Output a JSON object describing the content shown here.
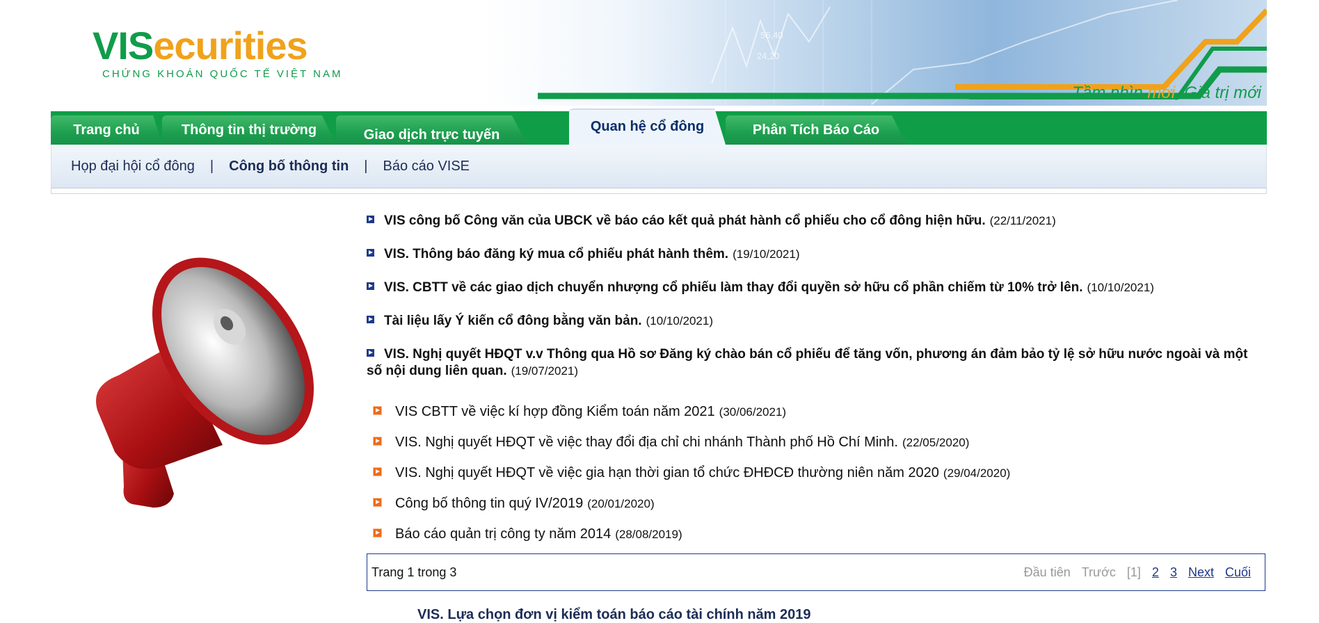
{
  "logo": {
    "vis": "VIS",
    "securities": "ecurities",
    "subtitle": "CHỨNG KHOÁN QUỐC TẾ VIỆT NAM"
  },
  "banner": {
    "slogan_a": "Tầm nhìn ",
    "slogan_b": "mới",
    "slogan_c": ", Giá trị mới",
    "chart_numbers": [
      "56,40",
      "24,20"
    ]
  },
  "nav": {
    "tabs": [
      {
        "label": "Trang chủ"
      },
      {
        "label": "Thông tin thị trường"
      },
      {
        "label": "Giao dịch trực tuyến"
      },
      {
        "label": "Quan hệ cổ đông"
      },
      {
        "label": "Phân Tích Báo Cáo"
      }
    ],
    "active_tab": "Quan hệ cổ đông"
  },
  "subnav": {
    "items": [
      {
        "label": "Họp đại hội cổ đông"
      },
      {
        "label": "Công bố thông tin"
      },
      {
        "label": "Báo cáo VISE"
      }
    ],
    "separator": "|"
  },
  "news": [
    {
      "title": "VIS công bố Công văn của UBCK về báo cáo kết quả phát hành cổ phiếu cho cổ đông hiện hữu.",
      "date": "(22/11/2021)"
    },
    {
      "title": "VIS. Thông báo đăng ký mua cổ phiếu phát hành thêm.",
      "date": "(19/10/2021)"
    },
    {
      "title": "VIS. CBTT về các giao dịch chuyển nhượng cổ phiếu làm thay đổi quyền sở hữu cổ phần chiếm từ 10% trở lên.",
      "date": "(10/10/2021)"
    },
    {
      "title": "Tài liệu lấy Ý kiến cổ đông bằng văn bản.",
      "date": "(10/10/2021)"
    },
    {
      "title": "VIS. Nghị quyết HĐQT v.v Thông qua Hồ sơ Đăng ký chào bán cổ phiếu để tăng vốn, phương án đảm bảo tỷ lệ sở hữu nước ngoài và một số nội dung liên quan.",
      "date": "(19/07/2021)"
    }
  ],
  "older_news": [
    {
      "title": "VIS CBTT về việc kí hợp đồng Kiểm toán năm 2021",
      "date": "(30/06/2021)"
    },
    {
      "title": "VIS. Nghị quyết HĐQT về việc thay đổi địa chỉ chi nhánh Thành phố Hồ Chí Minh.",
      "date": "(22/05/2020)"
    },
    {
      "title": "VIS. Nghị quyết HĐQT về việc gia hạn thời gian tổ chức ĐHĐCĐ thường niên năm 2020",
      "date": "(29/04/2020)"
    },
    {
      "title": "Công bố thông tin quý IV/2019",
      "date": "(20/01/2020)"
    },
    {
      "title": "Báo cáo quản trị công ty năm 2014",
      "date": "(28/08/2019)"
    }
  ],
  "pager": {
    "info": "Trang 1 trong 3",
    "first": "Đầu tiên",
    "prev": "Trước",
    "current": "[1]",
    "pages": [
      "2",
      "3"
    ],
    "next": "Next",
    "last": "Cuối"
  },
  "next_heading": "VIS. Lựa chọn đơn vị kiểm toán báo cáo tài chính năm 2019",
  "colors": {
    "brand_green": "#0f9e47",
    "brand_orange": "#f0a21b",
    "navy": "#1d3a8a",
    "bullet_orange": "#f06a1a"
  }
}
